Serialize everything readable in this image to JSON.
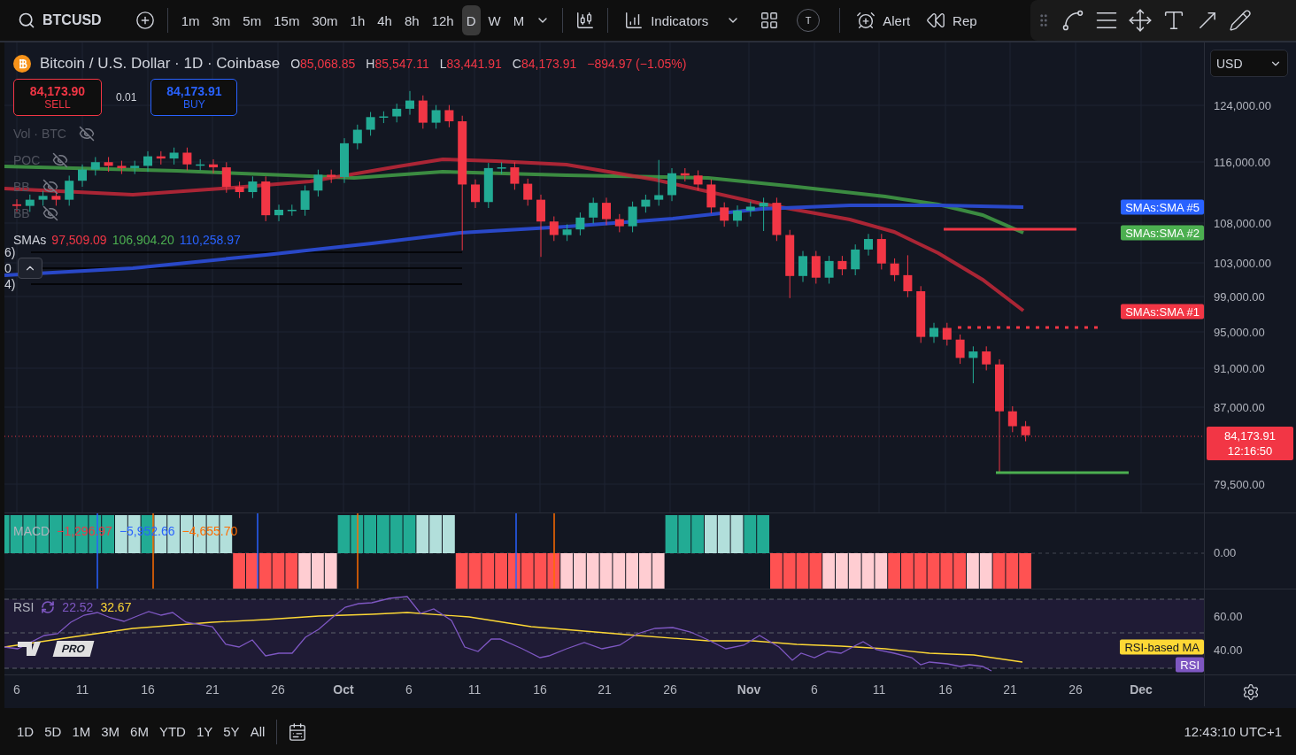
{
  "toolbar": {
    "symbol": "BTCUSD",
    "timeframes": [
      {
        "label": "1m",
        "selected": false
      },
      {
        "label": "3m",
        "selected": false
      },
      {
        "label": "5m",
        "selected": false
      },
      {
        "label": "15m",
        "selected": false
      },
      {
        "label": "30m",
        "selected": false
      },
      {
        "label": "1h",
        "selected": false
      },
      {
        "label": "4h",
        "selected": false
      },
      {
        "label": "8h",
        "selected": false
      },
      {
        "label": "12h",
        "selected": false
      },
      {
        "label": "D",
        "selected": true
      },
      {
        "label": "W",
        "selected": false
      },
      {
        "label": "M",
        "selected": false
      }
    ],
    "indicators_label": "Indicators",
    "avatar_letter": "T",
    "alert_label": "Alert",
    "replay_label": "Rep"
  },
  "legend": {
    "title": "Bitcoin / U.S. Dollar · 1D · Coinbase",
    "ohlc": [
      {
        "label": "O",
        "value": "85,068.85"
      },
      {
        "label": "H",
        "value": "85,547.11"
      },
      {
        "label": "L",
        "value": "83,441.91"
      },
      {
        "label": "C",
        "value": "84,173.91"
      }
    ],
    "change": "−894.97 (−1.05%)",
    "sell": {
      "price": "84,173.90",
      "label": "SELL"
    },
    "spread": "0.01",
    "buy": {
      "price": "84,173.91",
      "label": "BUY"
    },
    "studies": [
      {
        "name": "Vol · BTC",
        "hidden": true
      },
      {
        "name": "POC",
        "hidden": true
      },
      {
        "name": "BB",
        "hidden": true
      },
      {
        "name": "BB",
        "hidden": true
      }
    ],
    "smas": {
      "name": "SMAs",
      "values": [
        {
          "text": "97,509.09",
          "color": "#f23645"
        },
        {
          "text": "106,904.20",
          "color": "#4caf50"
        },
        {
          "text": "110,258.97",
          "color": "#2962ff"
        }
      ]
    },
    "clipped_labels": [
      "6)",
      "0",
      "4)"
    ]
  },
  "price_axis": {
    "currency": "USD",
    "labels": [
      "124,000.00",
      "116,000.00",
      "108,000.00",
      "103,000.00",
      "99,000.00",
      "95,000.00",
      "91,000.00",
      "87,000.00",
      "79,500.00"
    ],
    "last_price": "84,173.91",
    "countdown": "12:16:50"
  },
  "sma_tags": [
    {
      "label": "SMAs:SMA #5",
      "color": "#2962ff"
    },
    {
      "label": "SMAs:SMA #2",
      "color": "#4caf50"
    },
    {
      "label": "SMAs:SMA #1",
      "color": "#f23645"
    }
  ],
  "macd": {
    "name": "MACD",
    "values": [
      {
        "text": "−1,296.97",
        "color": "#f23645"
      },
      {
        "text": "−5,952.66",
        "color": "#2962ff"
      },
      {
        "text": "−4,655.70",
        "color": "#ff6d00"
      }
    ],
    "axis_label": "0.00"
  },
  "rsi": {
    "name": "RSI",
    "values": [
      {
        "text": "22.52",
        "color": "#7e57c2"
      },
      {
        "text": "32.67",
        "color": "#fdd835"
      }
    ],
    "axis_labels": [
      "60.00",
      "40.00"
    ],
    "tags": [
      {
        "label": "RSI-based MA",
        "color": "#fdd835"
      },
      {
        "label": "RSI",
        "color": "#7e57c2"
      }
    ]
  },
  "logo": {
    "badge": "PRO"
  },
  "time_axis": {
    "labels": [
      {
        "text": "6",
        "kind": "day"
      },
      {
        "text": "11",
        "kind": "day"
      },
      {
        "text": "16",
        "kind": "day"
      },
      {
        "text": "21",
        "kind": "day"
      },
      {
        "text": "26",
        "kind": "day"
      },
      {
        "text": "Oct",
        "kind": "month"
      },
      {
        "text": "6",
        "kind": "day"
      },
      {
        "text": "11",
        "kind": "day"
      },
      {
        "text": "16",
        "kind": "day"
      },
      {
        "text": "21",
        "kind": "day"
      },
      {
        "text": "26",
        "kind": "day"
      },
      {
        "text": "Nov",
        "kind": "month"
      },
      {
        "text": "6",
        "kind": "day"
      },
      {
        "text": "11",
        "kind": "day"
      },
      {
        "text": "16",
        "kind": "day"
      },
      {
        "text": "21",
        "kind": "day"
      },
      {
        "text": "26",
        "kind": "day"
      },
      {
        "text": "Dec",
        "kind": "month"
      }
    ]
  },
  "bottom_bar": {
    "ranges": [
      "1D",
      "5D",
      "1M",
      "3M",
      "6M",
      "YTD",
      "1Y",
      "5Y",
      "All"
    ],
    "clock": "12:43:10 UTC+1"
  }
}
